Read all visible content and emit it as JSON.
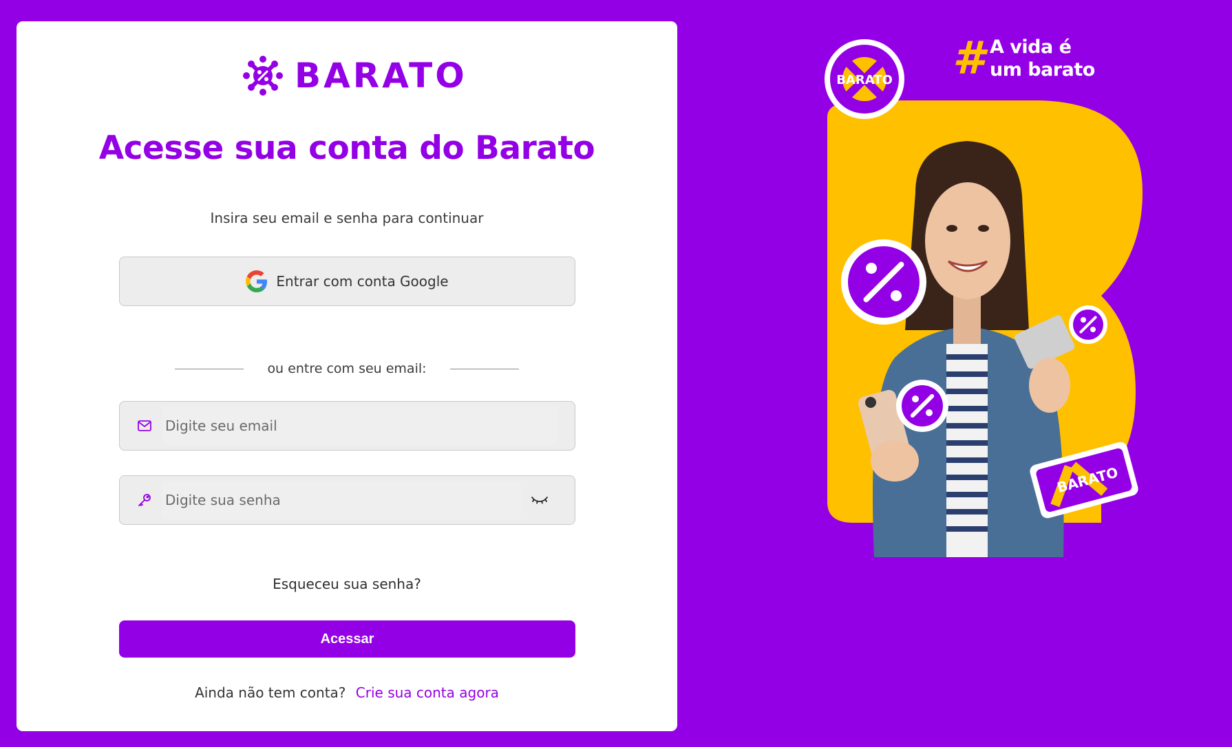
{
  "brand": {
    "name": "BARATO",
    "primary_color": "#9400e6",
    "accent_color": "#ffc000"
  },
  "login": {
    "title": "Acesse sua conta do Barato",
    "subtitle": "Insira seu email e senha para continuar",
    "google_button_label": "Entrar com conta Google",
    "divider_text": "ou entre com seu email:",
    "email_placeholder": "Digite seu email",
    "password_placeholder": "Digite sua senha",
    "forgot_password_label": "Esqueceu sua senha?",
    "submit_label": "Acessar",
    "signup_prompt": "Ainda não tem conta?",
    "signup_link_label": "Crie sua conta agora"
  },
  "promo": {
    "hashtag_line1": "A vida é",
    "hashtag_line2": "um barato",
    "badge_text": "BARATO",
    "card_text": "BARATO"
  },
  "icons": {
    "email": "mail-icon",
    "password": "key-icon",
    "toggle_password": "eye-closed-icon",
    "google": "google-icon"
  }
}
